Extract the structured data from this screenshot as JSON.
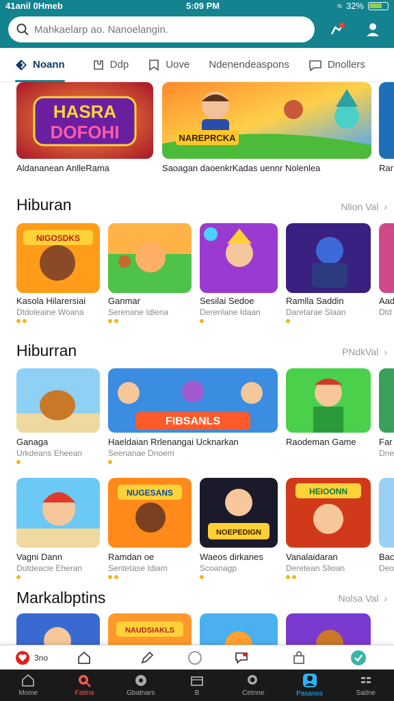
{
  "status": {
    "carrier": "41anil 0Hmeb",
    "time": "5:09 PM",
    "battery": "32%"
  },
  "header": {
    "search_placeholder": "Mahkaelarp ao. Nanoelangin."
  },
  "tabs": [
    {
      "label": "Noann",
      "icon": "diamond-icon"
    },
    {
      "label": "Ddp",
      "icon": "puzzle-icon"
    },
    {
      "label": "Uove",
      "icon": "bookmark-icon"
    },
    {
      "label": "Ndenendeaspons",
      "icon": ""
    },
    {
      "label": "Dnollers",
      "icon": "chat-icon"
    }
  ],
  "featured": [
    {
      "title": "Aldananean AnlleRama",
      "art": "HASRA DOFOHI"
    },
    {
      "title": "Saoagan daoenkrKadas uennr Nolenlea",
      "art": "NAREPRCKA"
    },
    {
      "title": "Rar",
      "art": ""
    }
  ],
  "sections": [
    {
      "title": "Hiburan",
      "see_all": "Nlion Val",
      "items": [
        {
          "title": "Kasola Hilarersiai",
          "sub": "Dtdoleaine Woana",
          "dots": 2,
          "art": "NIGOSDKS"
        },
        {
          "title": "Ganmar",
          "sub": "Serenane Idiena",
          "dots": 2,
          "art": ""
        },
        {
          "title": "Sesilai Sedoe",
          "sub": "Derenlane Idaan",
          "dots": 1,
          "art": ""
        },
        {
          "title": "Ramlla Saddin",
          "sub": "Daretarae Slaan",
          "dots": 1,
          "art": ""
        },
        {
          "title": "Aad",
          "sub": "Dtd",
          "dots": 0,
          "art": ""
        }
      ]
    },
    {
      "title": "Hiburran",
      "see_all": "PNdkVal",
      "items": [
        {
          "title": "Ganaga",
          "sub": "Urkdeans Eheean",
          "dots": 1,
          "art": ""
        },
        {
          "title": "Haeldaian Rrlenangai Ucknarkan",
          "sub": "Seenanae Dnoem",
          "dots": 1,
          "art": "FIBSANLS"
        },
        {
          "title": "Raodeman Game",
          "sub": "",
          "dots": 0,
          "art": ""
        },
        {
          "title": "Far",
          "sub": "Dne",
          "dots": 0,
          "art": ""
        }
      ]
    },
    {
      "title": "",
      "see_all": "",
      "items": [
        {
          "title": "Vagni Dann",
          "sub": "Dutdeacie Eheran",
          "dots": 1,
          "art": ""
        },
        {
          "title": "Ramdan oe",
          "sub": "Sentetase Idiam",
          "dots": 2,
          "art": "NUGESANS"
        },
        {
          "title": "Waeos dirkanes",
          "sub": "Scoanagp",
          "dots": 1,
          "art": "NOEPEDIGN"
        },
        {
          "title": "Vanalaidaran",
          "sub": "Deretean Slioan",
          "dots": 2,
          "art": "HEIOONN"
        },
        {
          "title": "Bac",
          "sub": "Deo",
          "dots": 0,
          "art": ""
        }
      ]
    },
    {
      "title": "Markalbptins",
      "see_all": "Nolsa Val",
      "items": [
        {
          "title": "",
          "sub": "",
          "dots": 0,
          "art": ""
        },
        {
          "title": "",
          "sub": "",
          "dots": 0,
          "art": "NAUDSIAKLS"
        },
        {
          "title": "",
          "sub": "",
          "dots": 0,
          "art": ""
        },
        {
          "title": "",
          "sub": "",
          "dots": 0,
          "art": ""
        }
      ]
    }
  ],
  "quickbar": [
    {
      "label": "3no",
      "icon": "heart-icon"
    },
    {
      "label": "",
      "icon": "home-icon"
    },
    {
      "label": "",
      "icon": "pen-icon"
    },
    {
      "label": "",
      "icon": "circle-icon"
    },
    {
      "label": "",
      "icon": "comment-icon"
    },
    {
      "label": "",
      "icon": "bag-icon"
    },
    {
      "label": "",
      "icon": "check-icon"
    }
  ],
  "bottom_nav": [
    {
      "label": "Mome",
      "icon": "home-icon"
    },
    {
      "label": "Fatina",
      "icon": "search-icon"
    },
    {
      "label": "Gbatnars",
      "icon": "chat-icon"
    },
    {
      "label": "B",
      "icon": "folder-icon"
    },
    {
      "label": "Cetnne",
      "icon": "search-icon"
    },
    {
      "label": "Pasanos",
      "icon": "user-icon"
    },
    {
      "label": "Saitne",
      "icon": "grid-icon"
    }
  ],
  "colors": {
    "header": "#12838f",
    "accent": "#2bb3ff",
    "rating": "#f2b51c",
    "nav_bg": "#1a1a1a"
  }
}
